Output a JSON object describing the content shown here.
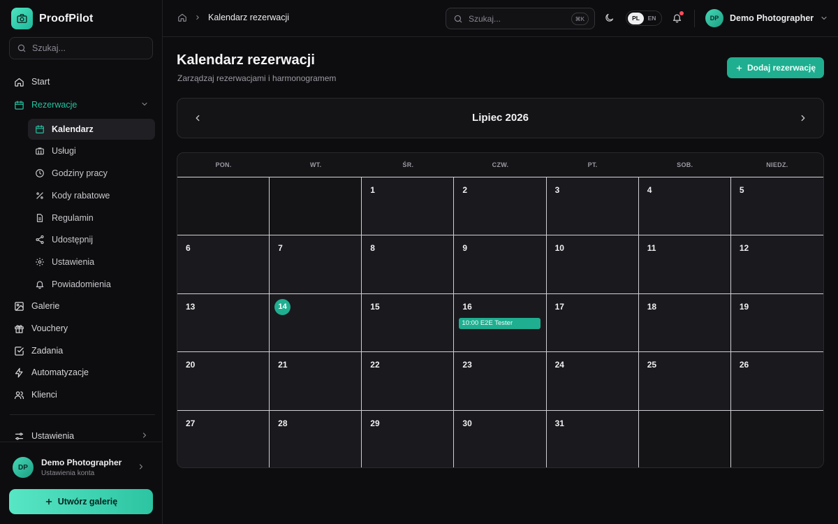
{
  "app": {
    "name": "ProofPilot"
  },
  "sidebar": {
    "search_placeholder": "Szukaj...",
    "items": [
      {
        "label": "Start",
        "icon": "home-icon"
      },
      {
        "label": "Rezerwacje",
        "icon": "calendar-icon"
      },
      {
        "label": "Galerie",
        "icon": "image-icon"
      },
      {
        "label": "Vouchery",
        "icon": "gift-icon"
      },
      {
        "label": "Zadania",
        "icon": "checkbox-icon"
      },
      {
        "label": "Automatyzacje",
        "icon": "zap-icon"
      },
      {
        "label": "Klienci",
        "icon": "users-icon"
      },
      {
        "label": "Ustawienia",
        "icon": "sliders-icon"
      }
    ],
    "sub_items": [
      {
        "label": "Kalendarz",
        "icon": "calendar-icon"
      },
      {
        "label": "Usługi",
        "icon": "briefcase-icon"
      },
      {
        "label": "Godziny pracy",
        "icon": "clock-icon"
      },
      {
        "label": "Kody rabatowe",
        "icon": "percent-icon"
      },
      {
        "label": "Regulamin",
        "icon": "file-icon"
      },
      {
        "label": "Udostępnij",
        "icon": "share-icon"
      },
      {
        "label": "Ustawienia",
        "icon": "gear-icon"
      },
      {
        "label": "Powiadomienia",
        "icon": "bell-icon"
      }
    ],
    "account": {
      "initials": "DP",
      "name": "Demo Photographer",
      "subtitle": "Ustawienia konta"
    },
    "create_button": "Utwórz galerię"
  },
  "topbar": {
    "breadcrumb": "Kalendarz rezerwacji",
    "search_placeholder": "Szukaj...",
    "shortcut": "⌘K",
    "lang_active": "PL",
    "lang_other": "EN",
    "user_initials": "DP",
    "user_name": "Demo Photographer"
  },
  "page": {
    "title": "Kalendarz rezerwacji",
    "subtitle": "Zarządzaj rezerwacjami i harmonogramem",
    "add_button": "Dodaj rezerwację"
  },
  "calendar": {
    "month_label": "Lipiec 2026",
    "weekdays": [
      "PON.",
      "WT.",
      "ŚR.",
      "CZW.",
      "PT.",
      "SOB.",
      "NIEDZ."
    ],
    "days": [
      "",
      "",
      "1",
      "2",
      "3",
      "4",
      "5",
      "6",
      "7",
      "8",
      "9",
      "10",
      "11",
      "12",
      "13",
      "14",
      "15",
      "16",
      "17",
      "18",
      "19",
      "20",
      "21",
      "22",
      "23",
      "24",
      "25",
      "26",
      "27",
      "28",
      "29",
      "30",
      "31",
      "",
      ""
    ],
    "today": "14",
    "events": [
      {
        "day": "16",
        "label": "10:00 E2E Tester"
      }
    ]
  },
  "colors": {
    "accent": "#1fae90",
    "background": "#0d0d0f",
    "notification": "#ff4d5e"
  }
}
